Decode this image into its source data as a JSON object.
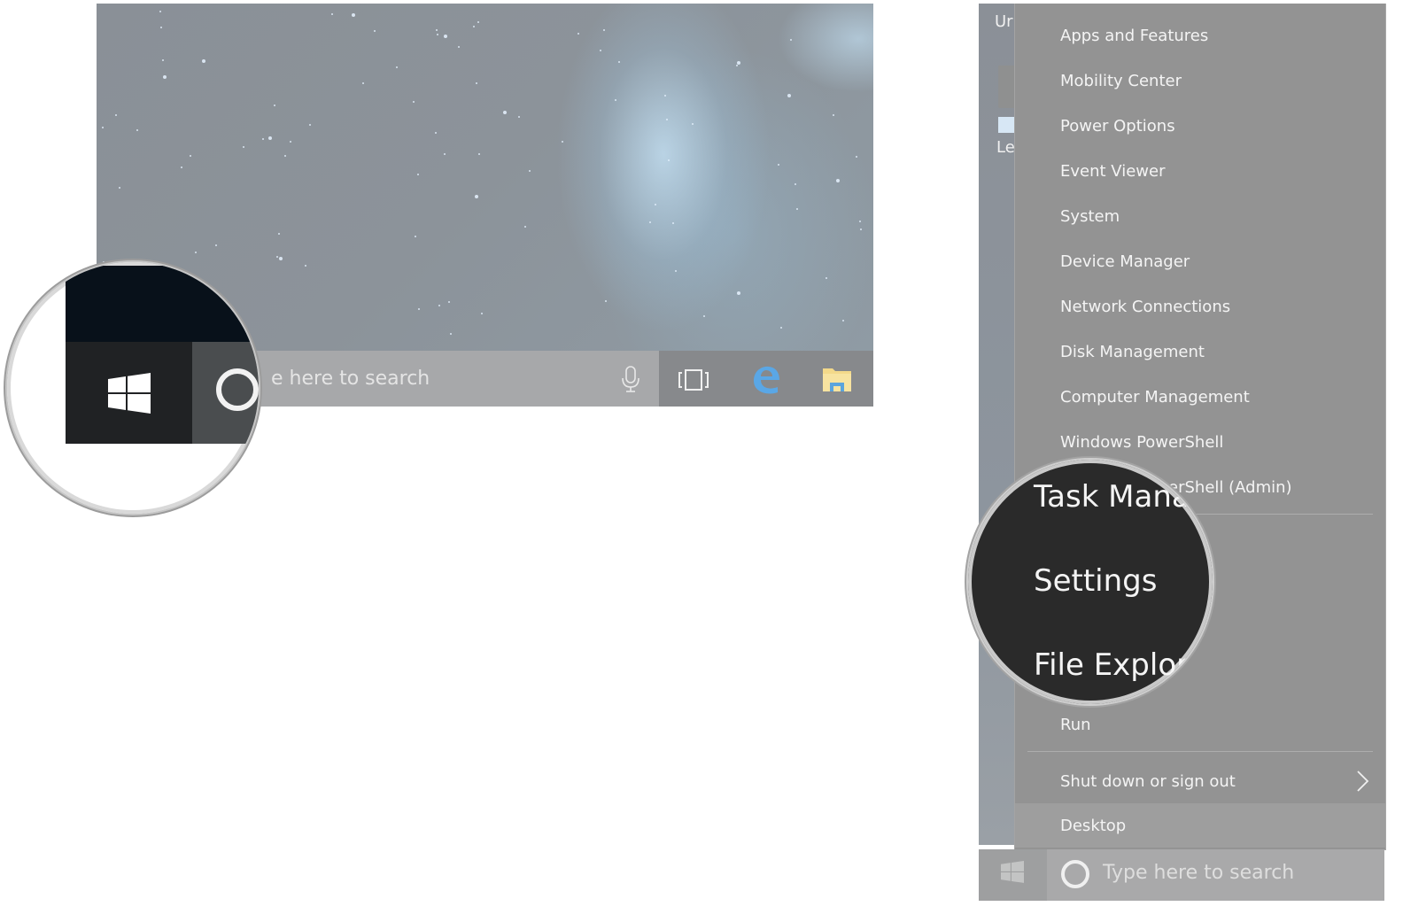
{
  "left_panel": {
    "taskbar": {
      "search_placeholder_visible": "e here to search",
      "icons": [
        "microphone-icon",
        "task-view-icon",
        "edge-browser-icon",
        "file-explorer-icon"
      ]
    },
    "magnifier": {
      "highlight": "start-button",
      "icons": [
        "windows-logo-icon",
        "cortana-ring-icon"
      ]
    }
  },
  "right_panel": {
    "desktop_labels": [
      "Ur",
      "Le"
    ],
    "menu": {
      "items": [
        {
          "label": "Apps and Features"
        },
        {
          "label": "Mobility Center"
        },
        {
          "label": "Power Options"
        },
        {
          "label": "Event Viewer"
        },
        {
          "label": "System"
        },
        {
          "label": "Device Manager"
        },
        {
          "label": "Network Connections"
        },
        {
          "label": "Disk Management"
        },
        {
          "label": "Computer Management"
        },
        {
          "label": "Windows PowerShell"
        },
        {
          "label": "Windows PowerShell (Admin)",
          "visible_part": "Shell (Admin)"
        },
        {
          "label": "Run"
        },
        {
          "label": "Shut down or sign out"
        },
        {
          "label": "Desktop"
        }
      ]
    },
    "magnifier": {
      "items": [
        "Task Manag",
        "Settings",
        "File Explor"
      ]
    },
    "taskbar": {
      "search_placeholder": "Type here to search"
    }
  },
  "colors": {
    "menu_bg": "#939393",
    "menu_highlight": "#9e9e9e",
    "magnifier_bg": "#2a2a2a",
    "edge_blue": "#5aa7e6",
    "folder_yellow": "#f3d98a"
  }
}
